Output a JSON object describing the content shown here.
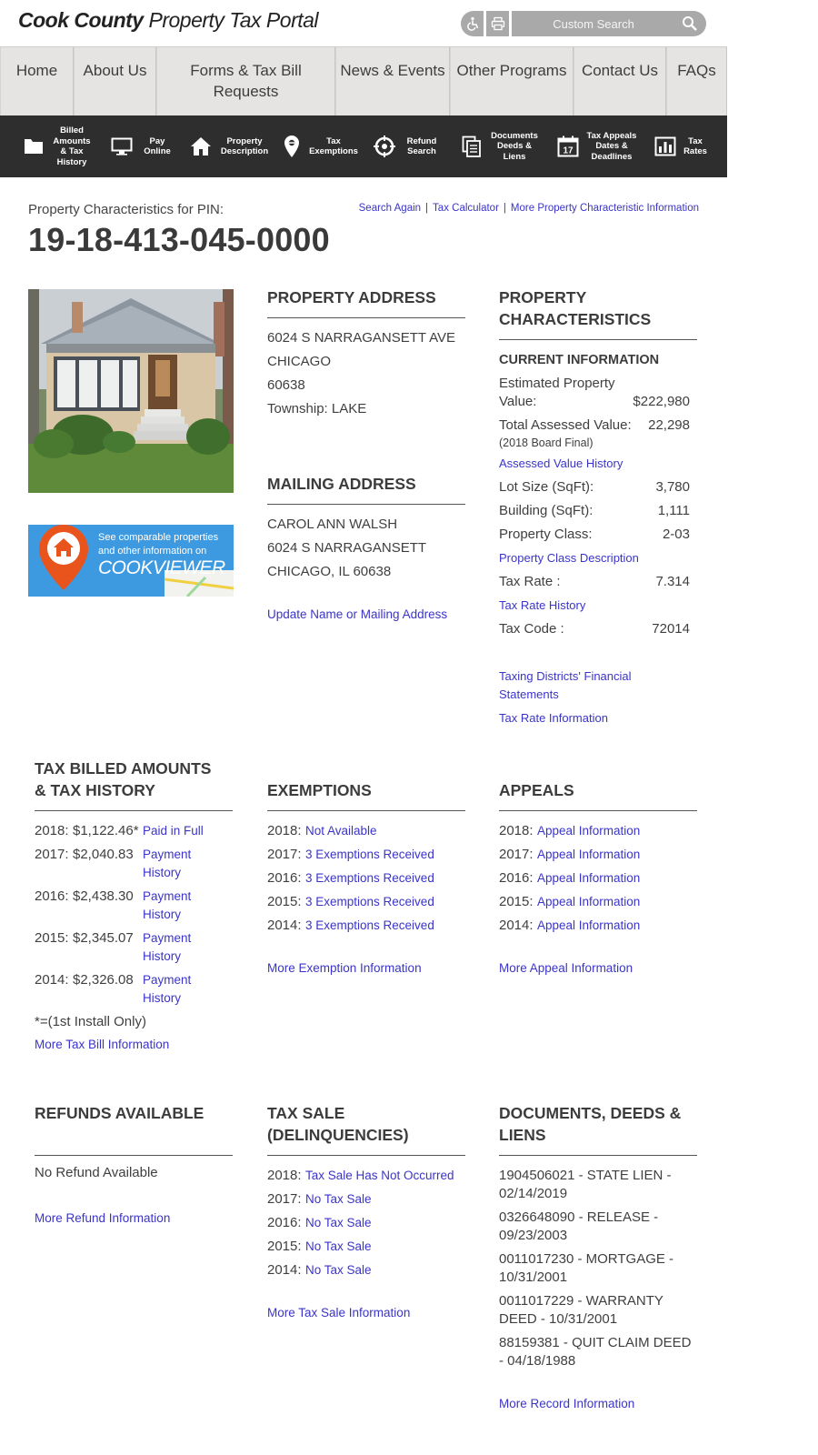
{
  "header": {
    "logo_bold": "Cook County",
    "logo_light": "Property Tax Portal",
    "accessibility_icon": "wheelchair-icon",
    "print_icon": "printer-icon",
    "search_placeholder": "Custom Search",
    "search_icon": "magnifier-icon"
  },
  "nav": {
    "items": [
      {
        "label": "Home"
      },
      {
        "label": "About Us"
      },
      {
        "label": "Forms & Tax Bill Requests"
      },
      {
        "label": "News & Events"
      },
      {
        "label": "Other Programs"
      },
      {
        "label": "Contact Us"
      },
      {
        "label": "FAQs"
      }
    ]
  },
  "iconbar": {
    "items": [
      {
        "label": "Billed Amounts & Tax History",
        "icon": "folder-icon"
      },
      {
        "label": "Pay Online",
        "icon": "monitor-icon"
      },
      {
        "label": "Property Description",
        "icon": "house-icon"
      },
      {
        "label": "Tax Exemptions",
        "icon": "map-pin-icon"
      },
      {
        "label": "Refund Search",
        "icon": "crosshair-icon"
      },
      {
        "label": "Documents Deeds & Liens",
        "icon": "documents-icon"
      },
      {
        "label": "Tax Appeals Dates & Deadlines",
        "icon": "calendar-icon",
        "day": "17"
      },
      {
        "label": "Tax Rates",
        "icon": "bar-chart-icon"
      }
    ]
  },
  "pin": {
    "caption": "Property Characteristics for PIN:",
    "number": "19-18-413-045-0000"
  },
  "toplinks": {
    "search_again": "Search Again",
    "tax_calculator": "Tax Calculator",
    "more_info": "More Property Characteristic Information",
    "separator": "|"
  },
  "viewer": {
    "text1": "See comparable properties",
    "text2": "and other information on",
    "brand_bold": "COOK",
    "brand_rest": "VIEWER"
  },
  "property_address": {
    "heading": "PROPERTY ADDRESS",
    "street": "6024 S NARRAGANSETT AVE",
    "city": "CHICAGO",
    "zip": "60638",
    "township": "Township: LAKE"
  },
  "mailing_address": {
    "heading": "MAILING ADDRESS",
    "name": "CAROL ANN WALSH",
    "street": "6024 S NARRAGANSETT",
    "city_state_zip": "CHICAGO, IL 60638",
    "update_link": "Update Name or Mailing Address"
  },
  "characteristics": {
    "heading": "PROPERTY CHARACTERISTICS",
    "subheading": "CURRENT INFORMATION",
    "estimated_label": "Estimated Property Value:",
    "estimated_value": "$222,980",
    "assessed_label": "Total Assessed Value:",
    "assessed_value": "22,298",
    "assessed_note": "(2018 Board Final)",
    "assessed_history_link": "Assessed Value History",
    "lot_label": "Lot Size (SqFt):",
    "lot_value": "3,780",
    "building_label": "Building (SqFt):",
    "building_value": "1,111",
    "class_label": "Property Class:",
    "class_value": "2-03",
    "class_link": "Property Class Description",
    "rate_label": "Tax Rate :",
    "rate_value": "7.314",
    "rate_link": "Tax Rate History",
    "code_label": "Tax Code :",
    "code_value": "72014",
    "districts_link": "Taxing Districts' Financial Statements",
    "rate_info_link": "Tax Rate Information"
  },
  "tax_billed": {
    "heading": "TAX BILLED AMOUNTS & TAX HISTORY",
    "rows": [
      {
        "year": "2018:",
        "amount": "$1,122.46*",
        "link": "Paid in Full"
      },
      {
        "year": "2017:",
        "amount": "$2,040.83",
        "link": "Payment History"
      },
      {
        "year": "2016:",
        "amount": "$2,438.30",
        "link": "Payment History"
      },
      {
        "year": "2015:",
        "amount": "$2,345.07",
        "link": "Payment History"
      },
      {
        "year": "2014:",
        "amount": "$2,326.08",
        "link": "Payment History"
      }
    ],
    "footnote": "*=(1st Install Only)",
    "more_link": "More Tax Bill Information"
  },
  "exemptions": {
    "heading": "EXEMPTIONS",
    "rows": [
      {
        "year": "2018:",
        "link": "Not Available"
      },
      {
        "year": "2017:",
        "link": "3 Exemptions Received"
      },
      {
        "year": "2016:",
        "link": "3 Exemptions Received"
      },
      {
        "year": "2015:",
        "link": "3 Exemptions Received"
      },
      {
        "year": "2014:",
        "link": "3 Exemptions Received"
      }
    ],
    "more_link": "More Exemption Information"
  },
  "appeals": {
    "heading": "APPEALS",
    "rows": [
      {
        "year": "2018:",
        "link": "Appeal Information"
      },
      {
        "year": "2017:",
        "link": "Appeal Information"
      },
      {
        "year": "2016:",
        "link": "Appeal Information"
      },
      {
        "year": "2015:",
        "link": "Appeal Information"
      },
      {
        "year": "2014:",
        "link": "Appeal Information"
      }
    ],
    "more_link": "More Appeal Information"
  },
  "refunds": {
    "heading": "REFUNDS AVAILABLE",
    "status": "No Refund Available",
    "more_link": "More Refund Information"
  },
  "tax_sale": {
    "heading": "TAX SALE (DELINQUENCIES)",
    "rows": [
      {
        "year": "2018:",
        "link": "Tax Sale Has Not Occurred"
      },
      {
        "year": "2017:",
        "link": "No Tax Sale"
      },
      {
        "year": "2016:",
        "link": "No Tax Sale"
      },
      {
        "year": "2015:",
        "link": "No Tax Sale"
      },
      {
        "year": "2014:",
        "link": "No Tax Sale"
      }
    ],
    "more_link": "More Tax Sale Information"
  },
  "documents": {
    "heading": "DOCUMENTS, DEEDS & LIENS",
    "rows": [
      "1904506021 - STATE LIEN - 02/14/2019",
      "0326648090 - RELEASE - 09/23/2003",
      "0011017230 - MORTGAGE - 10/31/2001",
      "0011017229 - WARRANTY DEED - 10/31/2001",
      "88159381 - QUIT CLAIM DEED - 04/18/1988"
    ],
    "more_link": "More Record Information"
  },
  "colors": {
    "link": "#3b34c9",
    "iconbar": "#2e2e2e",
    "nav_bg": "#e6e3e3",
    "viewer_bg": "#3d9ae0",
    "pin_orange": "#e8541c"
  }
}
